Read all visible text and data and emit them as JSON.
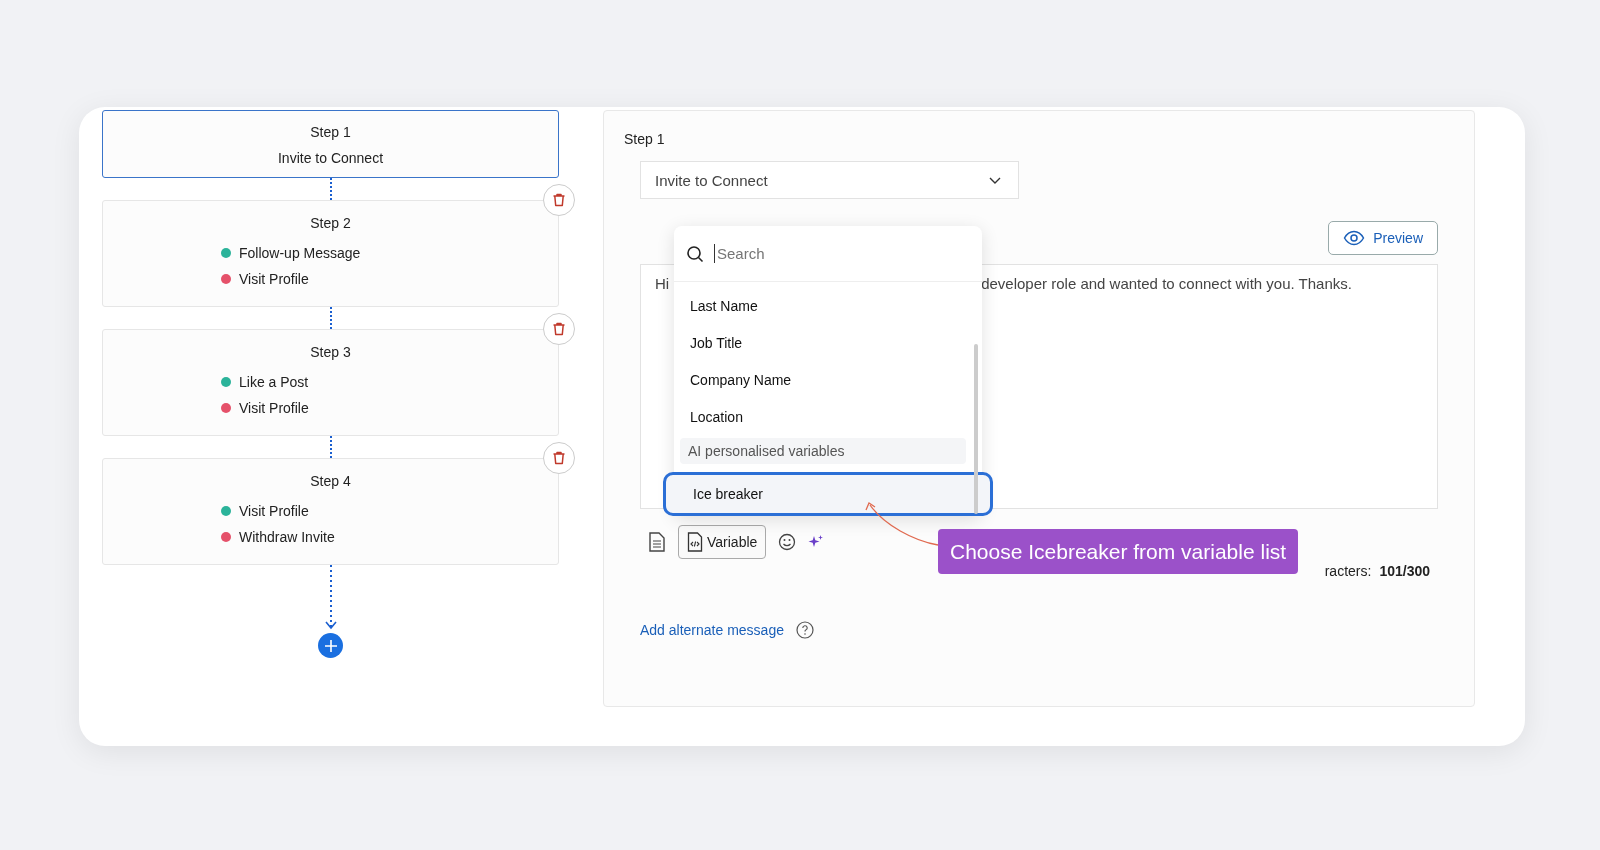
{
  "steps": [
    {
      "title": "Step 1",
      "action": "Invite to Connect",
      "selected": true,
      "deletable": false
    },
    {
      "title": "Step 2",
      "branches": [
        {
          "label": "Follow-up Message",
          "color": "#2bb39a"
        },
        {
          "label": "Visit Profile",
          "color": "#e5516a"
        }
      ],
      "selected": false,
      "deletable": true
    },
    {
      "title": "Step 3",
      "branches": [
        {
          "label": "Like a Post",
          "color": "#2bb39a"
        },
        {
          "label": "Visit Profile",
          "color": "#e5516a"
        }
      ],
      "selected": false,
      "deletable": true
    },
    {
      "title": "Step 4",
      "branches": [
        {
          "label": "Visit Profile",
          "color": "#2bb39a"
        },
        {
          "label": "Withdraw Invite",
          "color": "#e5516a"
        }
      ],
      "selected": false,
      "deletable": true
    }
  ],
  "editor": {
    "step_label": "Step 1",
    "action_select": {
      "value": "Invite to Connect"
    },
    "preview_button": "Preview",
    "message_visible": [
      "Hi",
      "developer role and wanted to connect with you. Thanks."
    ],
    "variable_button": "Variable",
    "character_count": {
      "label": "racters:",
      "value": "101/300"
    },
    "alternate_link": "Add alternate message"
  },
  "variable_menu": {
    "search": {
      "placeholder": "Search"
    },
    "items": [
      {
        "kind": "option",
        "label": "Last Name",
        "selected": false
      },
      {
        "kind": "option",
        "label": "Job Title",
        "selected": false
      },
      {
        "kind": "option",
        "label": "Company Name",
        "selected": false
      },
      {
        "kind": "option",
        "label": "Location",
        "selected": false
      },
      {
        "kind": "header",
        "label": "AI personalised variables"
      },
      {
        "kind": "option",
        "label": "Ice breaker",
        "selected": true
      }
    ]
  },
  "callout": "Choose Icebreaker from variable list"
}
